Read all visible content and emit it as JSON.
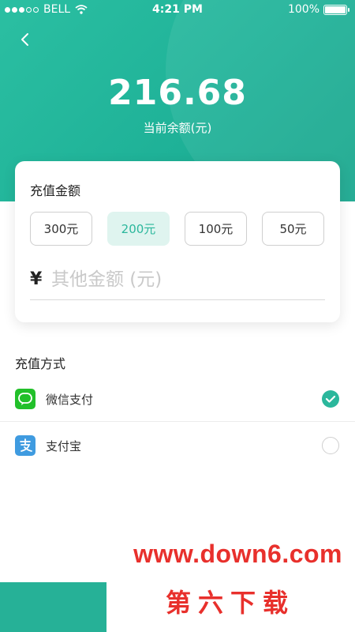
{
  "status_bar": {
    "carrier": "BELL",
    "time": "4:21 PM",
    "battery": "100%",
    "battery_level": 1.0
  },
  "header": {
    "balance": "216.68",
    "balance_label": "当前余额(元)"
  },
  "recharge": {
    "title": "充值金额",
    "amounts": [
      "300元",
      "200元",
      "100元",
      "50元"
    ],
    "selected_amount": "200元",
    "currency_symbol": "¥",
    "other_placeholder": "其他金额 (元)",
    "other_value": ""
  },
  "payment": {
    "title": "充值方式",
    "methods": [
      {
        "label": "微信支付",
        "icon": "wechat-icon",
        "checked": true
      },
      {
        "label": "支付宝",
        "icon": "alipay-icon",
        "checked": false
      }
    ]
  },
  "watermark": {
    "url": "www.down6.com",
    "text": "第六下载"
  },
  "colors": {
    "accent": "#2bb79c",
    "selected_bg": "#dff4ef",
    "wechat": "#22c02a",
    "alipay": "#3f9be0",
    "watermark": "#e8302c"
  }
}
